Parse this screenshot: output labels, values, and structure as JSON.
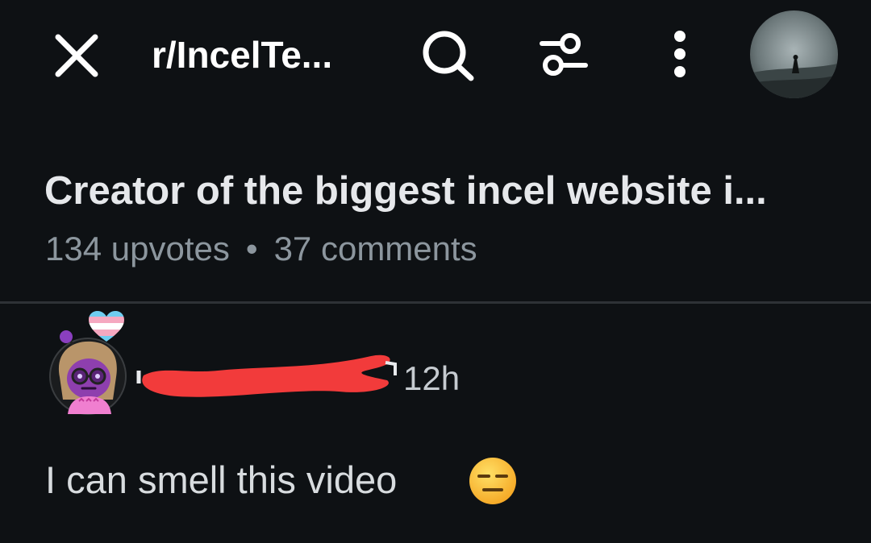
{
  "header": {
    "subreddit": "r/IncelTe...",
    "icons": [
      "close-icon",
      "search-icon",
      "filter-icon",
      "more-vertical-icon"
    ],
    "avatar": "user-avatar"
  },
  "post": {
    "title": "Creator of the biggest incel website i...",
    "upvotes": "134 upvotes",
    "separator": "•",
    "comments": "37 comments"
  },
  "comment": {
    "time": "12h",
    "body": "I can smell this video",
    "emoji": "expressionless-face-emoji",
    "author_redacted": true,
    "badge": "heart-icon"
  },
  "colors": {
    "background": "#0e1114",
    "text_primary": "#e6e8eb",
    "text_secondary": "#8c969e",
    "redaction": "#f23b3b"
  }
}
